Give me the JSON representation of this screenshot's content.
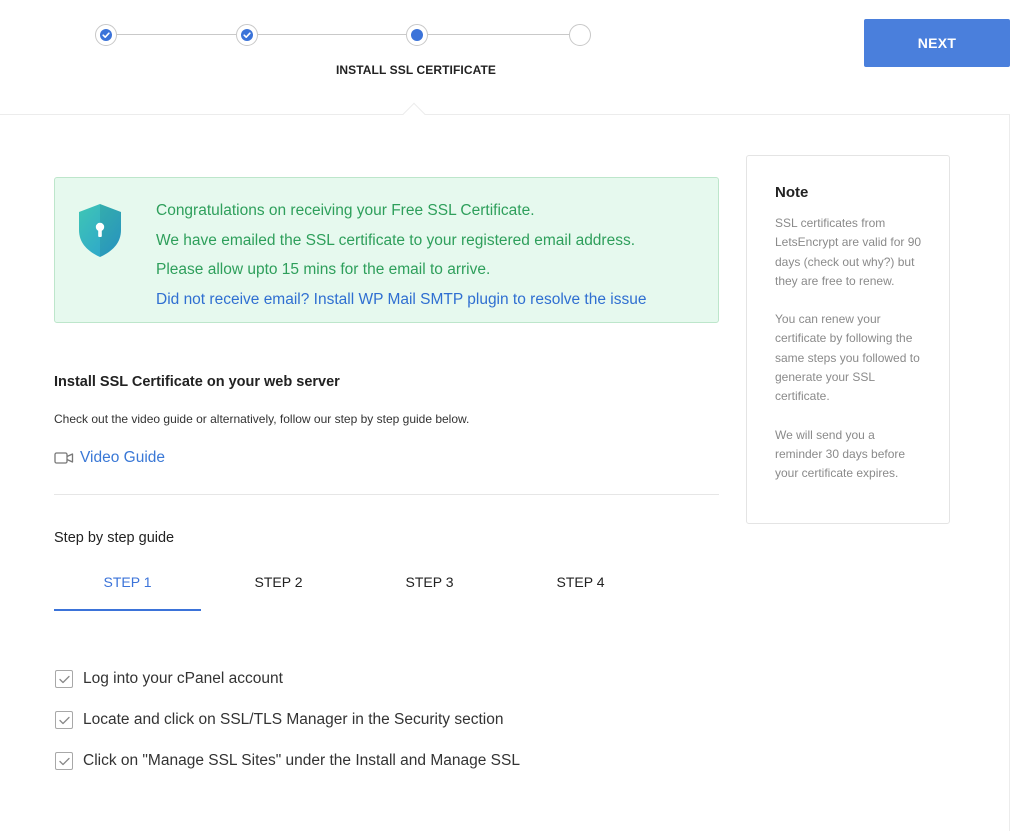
{
  "progress": {
    "steps": [
      {
        "state": "done"
      },
      {
        "state": "done"
      },
      {
        "state": "current"
      },
      {
        "state": "pending"
      }
    ],
    "current_label": "INSTALL SSL CERTIFICATE"
  },
  "toolbar": {
    "next_label": "NEXT"
  },
  "success": {
    "line1": "Congratulations on receiving your Free SSL Certificate.",
    "line2": "We have emailed the SSL certificate to your registered email address.",
    "line3": "Please allow upto 15 mins for the email to arrive.",
    "link": "Did not receive email? Install WP Mail SMTP plugin to resolve the issue",
    "icon": "shield-lock-icon"
  },
  "install": {
    "title": "Install SSL Certificate on your web server",
    "subtitle": "Check out the video guide or alternatively, follow our step by step guide below.",
    "video_link": "Video Guide",
    "video_icon": "video-camera-icon"
  },
  "guide": {
    "title": "Step by step guide",
    "tabs": [
      "STEP 1",
      "STEP 2",
      "STEP 3",
      "STEP 4"
    ],
    "active_tab": 0,
    "items": [
      "Log into your cPanel account",
      "Locate and click on SSL/TLS Manager in the Security section",
      "Click on \"Manage SSL Sites\" under the Install and Manage SSL"
    ]
  },
  "note": {
    "title": "Note",
    "p1": "SSL certificates from LetsEncrypt are valid for 90 days (check out why?) but they are free to renew.",
    "p2": "You can renew your certificate by following the same steps you followed to generate your SSL certificate.",
    "p3": "We will send you a reminder 30 days before your certificate expires."
  },
  "colors": {
    "accent": "#3b73d9",
    "success_text": "#2e9f5b",
    "success_bg": "#e6f9ee",
    "link": "#2f6fd1"
  }
}
